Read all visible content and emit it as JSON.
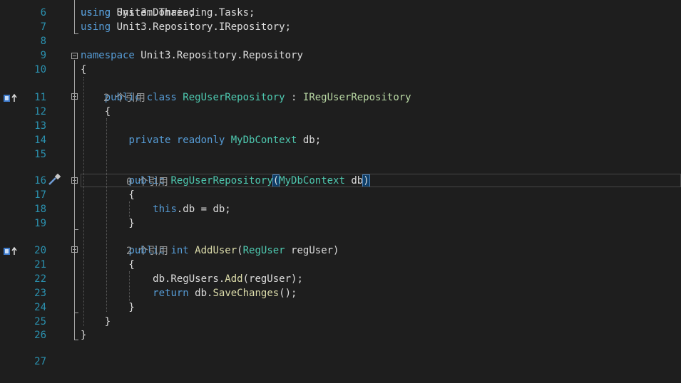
{
  "lines": [
    {
      "num": "6",
      "tokens": [
        {
          "c": "kw",
          "t": "using "
        },
        {
          "c": "pl",
          "t": "Unit3.Domain;"
        }
      ]
    },
    {
      "num": "7",
      "tokens": [
        {
          "c": "kw",
          "t": "using "
        },
        {
          "c": "pl",
          "t": "Unit3.Repository.IRepository;"
        }
      ]
    },
    {
      "num": "8",
      "tokens": []
    },
    {
      "num": "9",
      "tokens": [
        {
          "c": "kw",
          "t": "namespace "
        },
        {
          "c": "pl",
          "t": "Unit3.Repository.Repository"
        }
      ]
    },
    {
      "num": "10",
      "tokens": [
        {
          "c": "pl",
          "t": "{"
        }
      ]
    },
    {
      "num": "11",
      "tokens": [
        {
          "c": "pl",
          "t": "    "
        },
        {
          "c": "kw",
          "t": "public class "
        },
        {
          "c": "ty",
          "t": "RegUserRepository"
        },
        {
          "c": "pl",
          "t": " : "
        },
        {
          "c": "if",
          "t": "IRegUserRepository"
        }
      ]
    },
    {
      "num": "12",
      "tokens": [
        {
          "c": "pl",
          "t": "    {"
        }
      ]
    },
    {
      "num": "13",
      "tokens": []
    },
    {
      "num": "14",
      "tokens": [
        {
          "c": "pl",
          "t": "        "
        },
        {
          "c": "kw",
          "t": "private readonly "
        },
        {
          "c": "ty",
          "t": "MyDbContext"
        },
        {
          "c": "pl",
          "t": " db;"
        }
      ]
    },
    {
      "num": "15",
      "tokens": []
    },
    {
      "num": "16",
      "tokens": [
        {
          "c": "pl",
          "t": "        "
        },
        {
          "c": "kw",
          "t": "public "
        },
        {
          "c": "ty",
          "t": "RegUserRepository"
        },
        {
          "c": "pl brace-hl",
          "t": "("
        },
        {
          "c": "ty",
          "t": "MyDbContext"
        },
        {
          "c": "pl",
          "t": " db"
        },
        {
          "c": "pl brace-hl",
          "t": ")"
        }
      ]
    },
    {
      "num": "17",
      "tokens": [
        {
          "c": "pl",
          "t": "        {"
        }
      ]
    },
    {
      "num": "18",
      "tokens": [
        {
          "c": "pl",
          "t": "            "
        },
        {
          "c": "kw",
          "t": "this"
        },
        {
          "c": "pl",
          "t": ".db = db;"
        }
      ]
    },
    {
      "num": "19",
      "tokens": [
        {
          "c": "pl",
          "t": "        }"
        }
      ]
    },
    {
      "num": "20",
      "tokens": [
        {
          "c": "pl",
          "t": "        "
        },
        {
          "c": "kw",
          "t": "public int "
        },
        {
          "c": "fn",
          "t": "AddUser"
        },
        {
          "c": "pl",
          "t": "("
        },
        {
          "c": "ty",
          "t": "RegUser"
        },
        {
          "c": "pl",
          "t": " regUser)"
        }
      ]
    },
    {
      "num": "21",
      "tokens": [
        {
          "c": "pl",
          "t": "        {"
        }
      ]
    },
    {
      "num": "22",
      "tokens": [
        {
          "c": "pl",
          "t": "            db.RegUsers."
        },
        {
          "c": "fn",
          "t": "Add"
        },
        {
          "c": "pl",
          "t": "(regUser);"
        }
      ]
    },
    {
      "num": "23",
      "tokens": [
        {
          "c": "pl",
          "t": "            "
        },
        {
          "c": "kw",
          "t": "return "
        },
        {
          "c": "pl",
          "t": "db."
        },
        {
          "c": "fn",
          "t": "SaveChanges"
        },
        {
          "c": "pl",
          "t": "();"
        }
      ]
    },
    {
      "num": "24",
      "tokens": [
        {
          "c": "pl",
          "t": "        }"
        }
      ]
    },
    {
      "num": "25",
      "tokens": [
        {
          "c": "pl",
          "t": "    }"
        }
      ]
    },
    {
      "num": "26",
      "tokens": [
        {
          "c": "pl",
          "t": "}"
        }
      ]
    }
  ],
  "partial_top": {
    "tokens": [
      {
        "c": "kw",
        "t": "using "
      },
      {
        "c": "pl",
        "t": "System.Threading.Tasks;"
      }
    ]
  },
  "lens": {
    "class_refs": "2 个引用",
    "ctor_refs": "0 个引用",
    "method_refs": "2 个引用"
  },
  "gutter_icons": {
    "line11": "implements-interface-icon",
    "line16": "quick-actions-brush-icon",
    "line20": "implements-interface-icon"
  },
  "colors": {
    "background": "#1e1e1e",
    "keyword": "#569cd6",
    "type": "#4ec9b0",
    "interface": "#b8d7a3",
    "method": "#dcdcaa",
    "line_number": "#2b91af",
    "codelens": "#999999"
  }
}
